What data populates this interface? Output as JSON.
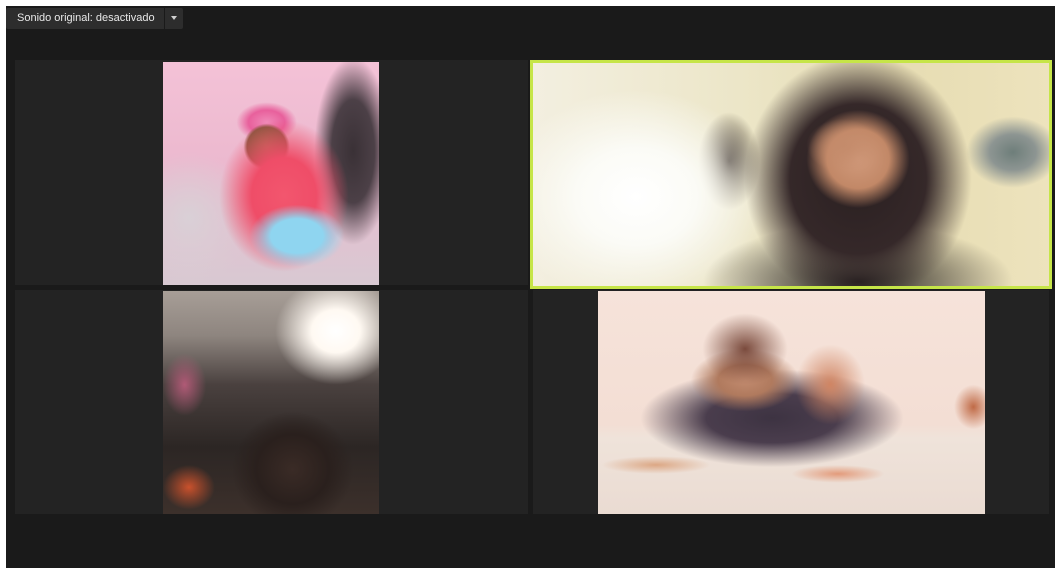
{
  "toolbar": {
    "original_sound_label": "Sonido original: desactivado",
    "original_sound_dropdown_icon": "chevron-down-icon"
  },
  "participants": [
    {
      "description_icon": "video-feed",
      "active_speaker": false
    },
    {
      "description_icon": "video-feed",
      "active_speaker": true,
      "highlight_color": "#c6e548"
    },
    {
      "description_icon": "video-feed",
      "active_speaker": false
    },
    {
      "description_icon": "video-feed",
      "active_speaker": false
    }
  ],
  "colors": {
    "background": "#1a1a1a",
    "tile_background": "#232323",
    "active_speaker_border": "#c6e548",
    "button_background": "#2d2d2d",
    "button_text": "#e8e8e8"
  }
}
